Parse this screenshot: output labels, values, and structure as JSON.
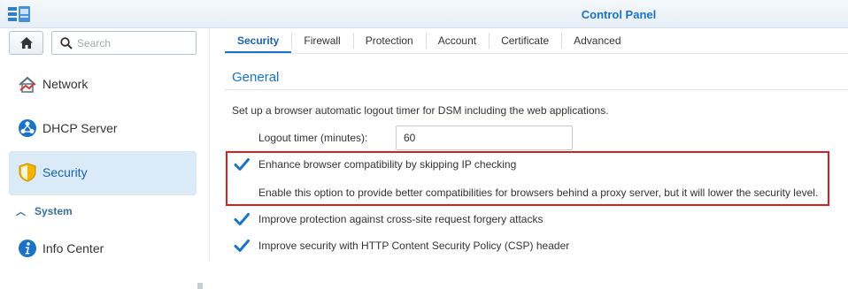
{
  "window": {
    "title": "Control Panel"
  },
  "sidebar": {
    "search_placeholder": "Search",
    "items": [
      {
        "label": "Network",
        "icon": "network-icon"
      },
      {
        "label": "DHCP Server",
        "icon": "dhcp-server-icon"
      },
      {
        "label": "Security",
        "icon": "shield-icon",
        "active": true
      }
    ],
    "group": {
      "label": "System",
      "icon": "chevron-up-icon"
    },
    "items_system": [
      {
        "label": "Info Center",
        "icon": "info-icon"
      }
    ]
  },
  "tabs": [
    "Security",
    "Firewall",
    "Protection",
    "Account",
    "Certificate",
    "Advanced"
  ],
  "active_tab": "Security",
  "main": {
    "section_title": "General",
    "description": "Set up a browser automatic logout timer for DSM including the web applications.",
    "logout_timer": {
      "label": "Logout timer (minutes):",
      "value": "60"
    },
    "options": [
      {
        "label": "Enhance browser compatibility by skipping IP checking",
        "checked": true
      },
      {
        "label": "Improve protection against cross-site request forgery attacks",
        "checked": true
      },
      {
        "label": "Improve security with HTTP Content Security Policy (CSP) header",
        "checked": true
      }
    ],
    "option_note": "Enable this option to provide better compatibilities for browsers behind a proxy server, but it will lower the security level."
  },
  "colors": {
    "accent": "#1a73c8",
    "highlight_border": "#d32020",
    "active_bg": "#dbeaf7"
  }
}
